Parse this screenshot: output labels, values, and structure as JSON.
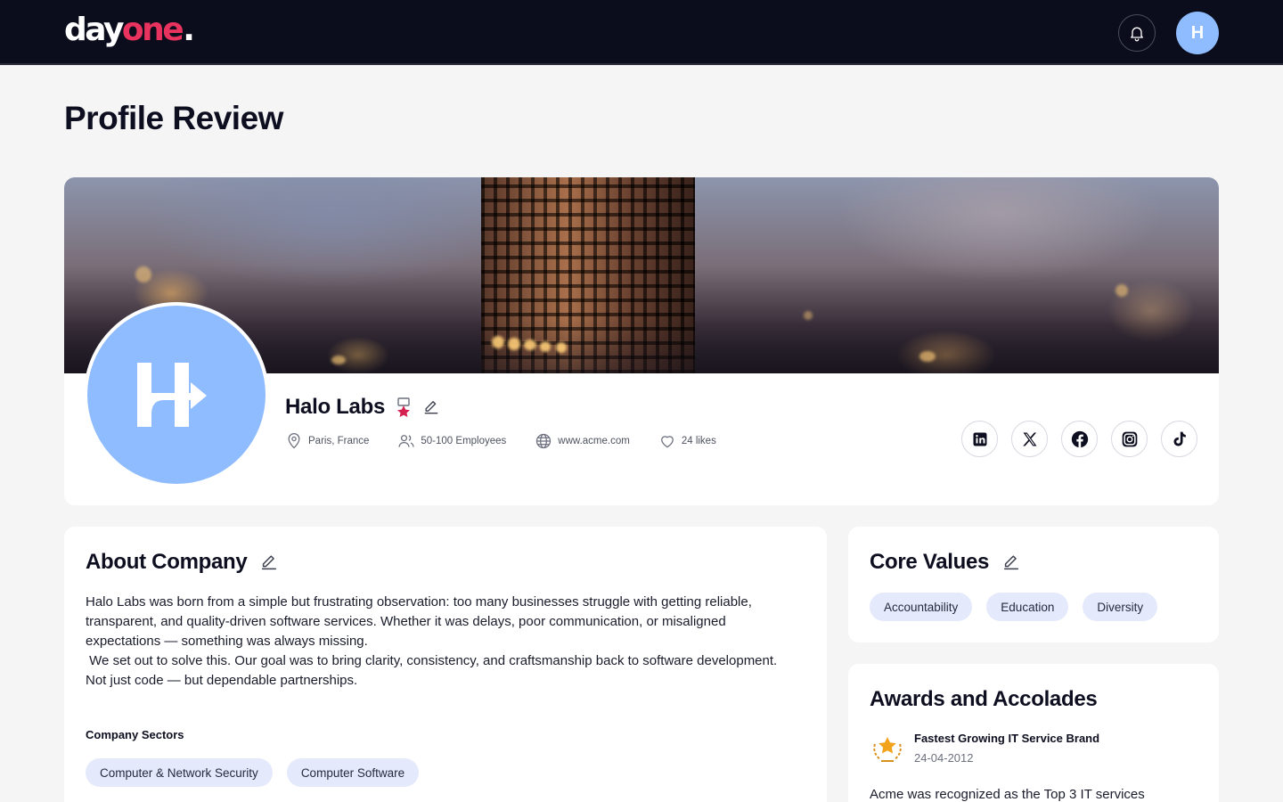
{
  "header": {
    "logo_day": "day",
    "logo_one": "one",
    "logo_dot": ".",
    "avatar_initial": "H",
    "colors": {
      "bg": "#0b0d1c",
      "brand_pink": "#e8335f",
      "avatar_blue": "#8fbcff"
    }
  },
  "page": {
    "title": "Profile Review"
  },
  "profile": {
    "company_name": "Halo Labs",
    "badge_icon": "medal-icon",
    "location": "Paris, France",
    "employees": "50-100 Employees",
    "website": "www.acme.com",
    "likes": "24 likes",
    "socials": [
      "linkedin-icon",
      "x-icon",
      "facebook-icon",
      "instagram-icon",
      "tiktok-icon"
    ]
  },
  "about": {
    "title": "About Company",
    "paragraph1": "Halo Labs was born from a simple but frustrating observation: too many businesses struggle with getting reliable, transparent, and quality-driven software services. Whether it was delays, poor communication, or misaligned expectations — something was always missing.",
    "paragraph2": " We set out to solve this. Our goal was to bring clarity, consistency, and craftsmanship back to software development. Not just code — but dependable partnerships.",
    "sectors_label": "Company Sectors",
    "sectors": [
      "Computer & Network Security",
      "Computer Software"
    ]
  },
  "core_values": {
    "title": "Core Values",
    "values": [
      "Accountability",
      "Education",
      "Diversity"
    ]
  },
  "awards": {
    "title": "Awards and Accolades",
    "items": [
      {
        "name": "Fastest Growing IT Service Brand",
        "date": "24-04-2012",
        "description": "Acme was recognized as the Top 3 IT services"
      }
    ]
  }
}
